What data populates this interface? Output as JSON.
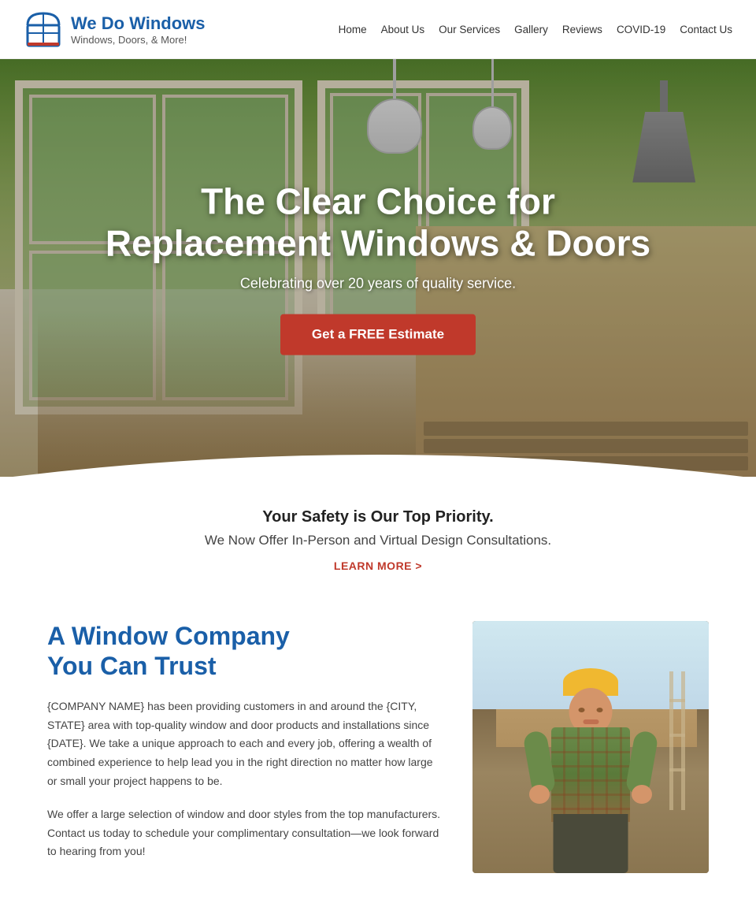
{
  "header": {
    "logo_title": "We Do Windows",
    "logo_subtitle": "Windows, Doors, & More!",
    "nav_items": [
      {
        "label": "Home",
        "href": "#"
      },
      {
        "label": "About Us",
        "href": "#"
      },
      {
        "label": "Our Services",
        "href": "#"
      },
      {
        "label": "Gallery",
        "href": "#"
      },
      {
        "label": "Reviews",
        "href": "#"
      },
      {
        "label": "COVID-19",
        "href": "#"
      },
      {
        "label": "Contact Us",
        "href": "#"
      }
    ]
  },
  "hero": {
    "title": "The Clear Choice for Replacement Windows & Doors",
    "subtitle": "Celebrating over 20 years of quality service.",
    "cta_button": "Get a FREE Estimate"
  },
  "safety": {
    "title": "Your Safety is Our Top Priority.",
    "subtitle": "We Now Offer In-Person and Virtual Design Consultations.",
    "learn_more": "LEARN MORE >"
  },
  "about": {
    "heading_line1": "A Window Company",
    "heading_line2": "You Can Trust",
    "paragraph1": "{COMPANY NAME} has been providing customers in and around the {CITY, STATE} area with top-quality window and door products and installations since {DATE}. We take a unique approach to each and every job, offering a wealth of combined experience to help lead you in the right direction no matter how large or small your project happens to be.",
    "paragraph2": "We offer a large selection of window and door styles from the top manufacturers. Contact us today to schedule your complimentary consultation—we look forward to hearing from you!"
  }
}
